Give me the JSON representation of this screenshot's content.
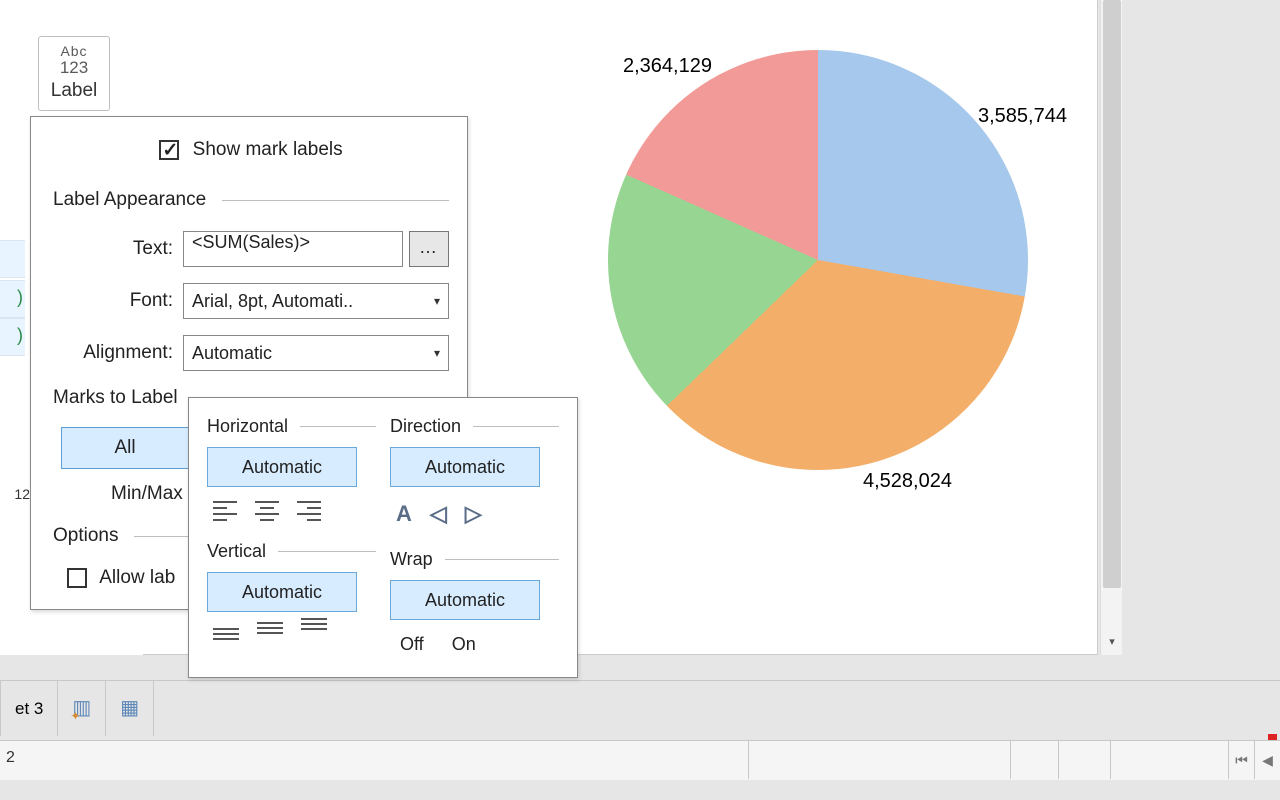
{
  "chart_data": {
    "type": "pie",
    "slices": [
      {
        "label": "3,585,744",
        "value": 3585744,
        "color": "#a5c8ec"
      },
      {
        "label": "4,528,024",
        "value": 4528024,
        "color": "#f3af6a"
      },
      {
        "label": "unlabeled_green",
        "value": 2440000,
        "color": "#97d593"
      },
      {
        "label": "2,364,129",
        "value": 2364129,
        "color": "#f29a97"
      }
    ],
    "visible_labels": [
      "3,585,744",
      "4,528,024",
      "2,364,129"
    ]
  },
  "marks_card": {
    "label_button_top": "Abc",
    "label_button_mid": "123",
    "label_button_caption": "Label"
  },
  "label_popup": {
    "show_mark_labels": {
      "label": "Show mark labels",
      "checked": true
    },
    "section_appearance": "Label Appearance",
    "text_label": "Text:",
    "text_value": "<SUM(Sales)>",
    "font_label": "Font:",
    "font_value": "Arial, 8pt, Automati..",
    "alignment_label": "Alignment:",
    "alignment_value": "Automatic",
    "section_marks": "Marks to Label",
    "all_button": "All",
    "minmax_text": "Min/Max",
    "section_options": "Options",
    "allow_overlap": {
      "label": "Allow lab",
      "checked": false
    }
  },
  "alignment_popup": {
    "horizontal_heading": "Horizontal",
    "direction_heading": "Direction",
    "vertical_heading": "Vertical",
    "wrap_heading": "Wrap",
    "automatic": "Automatic",
    "wrap_off": "Off",
    "wrap_on": "On"
  },
  "row_shelf_fragment": "12",
  "sheet_tabs": {
    "current": "et 3"
  },
  "status": {
    "left_fragment": "2"
  }
}
